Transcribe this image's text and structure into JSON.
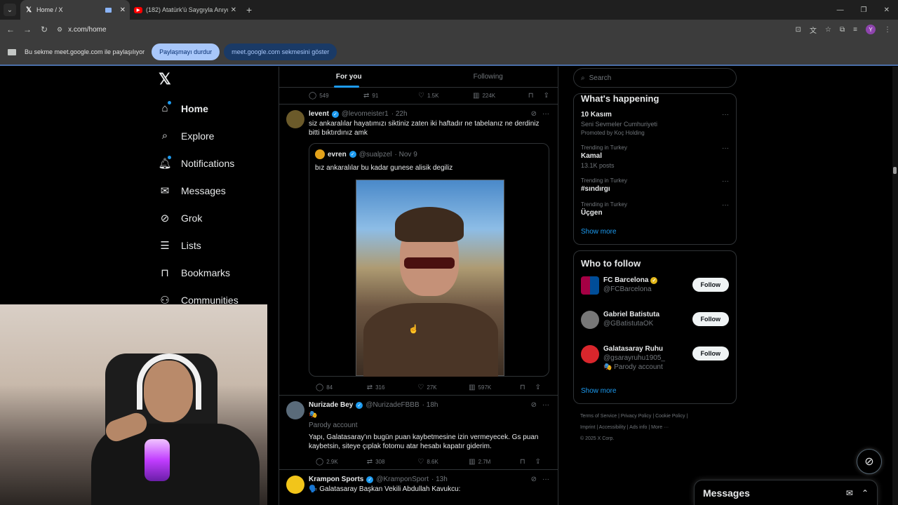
{
  "browser": {
    "tabs": [
      {
        "title": "Home / X",
        "favicon": "X"
      },
      {
        "title": "(182) Atatürk'ü Saygıyla Anıyor",
        "favicon": "youtube"
      }
    ],
    "url": "x.com/home",
    "profile_letter": "Y"
  },
  "sharebar": {
    "message": "Bu sekme meet.google.com ile paylaşılıyor",
    "stop_label": "Paylaşmayı durdur",
    "show_label": "meet.google.com sekmesini göster"
  },
  "nav": {
    "items": [
      {
        "label": "Home",
        "icon": "home-icon"
      },
      {
        "label": "Explore",
        "icon": "search-icon"
      },
      {
        "label": "Notifications",
        "icon": "bell-icon"
      },
      {
        "label": "Messages",
        "icon": "mail-icon"
      },
      {
        "label": "Grok",
        "icon": "grok-icon"
      },
      {
        "label": "Lists",
        "icon": "list-icon"
      },
      {
        "label": "Bookmarks",
        "icon": "bookmark-icon"
      },
      {
        "label": "Communities",
        "icon": "people-icon"
      }
    ]
  },
  "feed": {
    "tabs": [
      "For you",
      "Following"
    ],
    "top_actions": {
      "replies": "549",
      "reposts": "91",
      "likes": "1.5K",
      "views": "224K"
    },
    "posts": [
      {
        "name": "levent",
        "handle": "@levomeister1",
        "time": "· 22h",
        "text": "siz ankaralılar hayatımızı siktiniz zaten iki haftadır ne tabelanız ne derdiniz bitti bıktırdınız amk",
        "quote": {
          "name": "evren",
          "handle": "@sualpzel",
          "time": "· Nov 9",
          "text": "bız ankaralılar bu kadar gunese alisik degiliz"
        },
        "actions": {
          "replies": "84",
          "reposts": "316",
          "likes": "27K",
          "views": "597K"
        }
      },
      {
        "name": "Nurizade Bey",
        "handle": "@NurizadeFBBB",
        "time": "· 18h",
        "badge_line": "🎭",
        "sub": "Parody account",
        "text": "Yapı, Galatasaray'ın bugün puan kaybetmesine izin vermeyecek. Gs puan kaybetsin, siteye çıplak fotomu atar hesabı kapatır giderim.",
        "actions": {
          "replies": "2.9K",
          "reposts": "308",
          "likes": "8.6K",
          "views": "2.7M"
        }
      },
      {
        "name": "Krampon Sports",
        "handle": "@KramponSport",
        "time": "· 13h",
        "text": "🗣️ Galatasaray Başkan Vekili Abdullah Kavukcu:"
      }
    ]
  },
  "right": {
    "search_placeholder": "Search",
    "happening_title": "What's happening",
    "trends": [
      {
        "context": "",
        "title": "10 Kasım",
        "sub": "Seni Sevmeler Cumhuriyeti",
        "promo": "Promoted by Koç Holding"
      },
      {
        "context": "Trending in Turkey",
        "title": "Kamal",
        "sub": "13.1K posts"
      },
      {
        "context": "Trending in Turkey",
        "title": "#sındırgı",
        "sub": ""
      },
      {
        "context": "Trending in Turkey",
        "title": "Üçgen",
        "sub": ""
      }
    ],
    "show_more": "Show more",
    "who_title": "Who to follow",
    "follows": [
      {
        "name": "FC Barcelona",
        "handle": "@FCBarcelona",
        "extra": ""
      },
      {
        "name": "Gabriel Batistuta",
        "handle": "@GBatistutaOK",
        "extra": ""
      },
      {
        "name": "Galatasaray Ruhu",
        "handle": "@gsarayruhu1905_",
        "extra": "🎭 Parody account"
      }
    ],
    "follow_label": "Follow",
    "footer_line1": "Terms of Service  |  Privacy Policy  |  Cookie Policy  |",
    "footer_line2": "Imprint  |  Accessibility  |  Ads info  |  More ···",
    "footer_line3": "© 2025 X Corp."
  },
  "messages": {
    "title": "Messages"
  }
}
